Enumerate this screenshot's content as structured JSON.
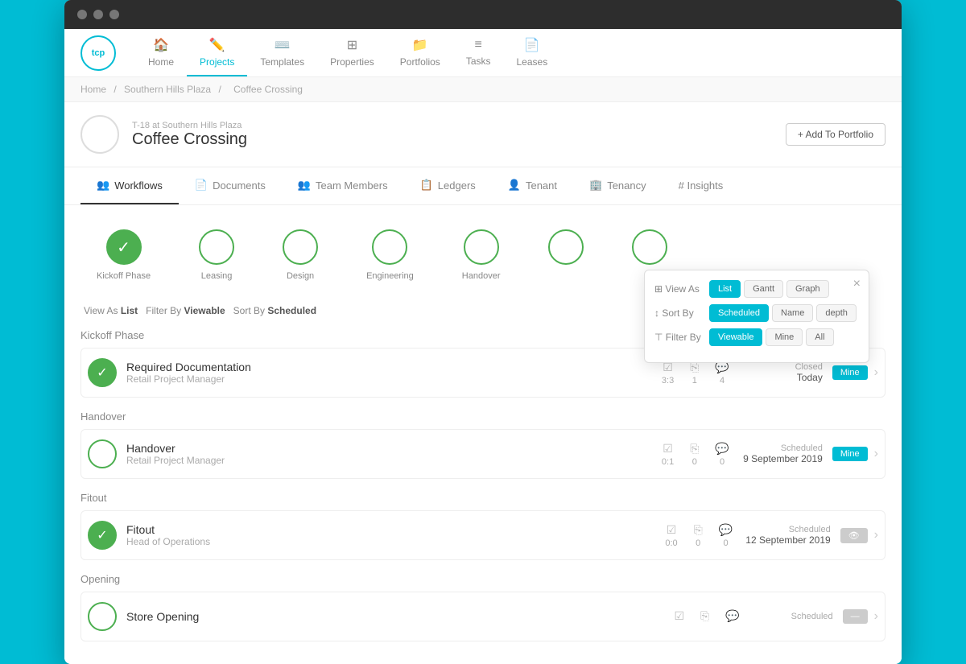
{
  "browser": {
    "dots": [
      "dot1",
      "dot2",
      "dot3"
    ]
  },
  "nav": {
    "logo": "tcp",
    "items": [
      {
        "id": "home",
        "label": "Home",
        "icon": "🏠",
        "active": false
      },
      {
        "id": "projects",
        "label": "Projects",
        "icon": "📐",
        "active": true
      },
      {
        "id": "templates",
        "label": "Templates",
        "icon": "</>",
        "active": false
      },
      {
        "id": "properties",
        "label": "Properties",
        "icon": "⊞",
        "active": false
      },
      {
        "id": "portfolios",
        "label": "Portfolios",
        "icon": "📁",
        "active": false
      },
      {
        "id": "tasks",
        "label": "Tasks",
        "icon": "≡",
        "active": false
      },
      {
        "id": "leases",
        "label": "Leases",
        "icon": "📄",
        "active": false
      }
    ]
  },
  "breadcrumb": {
    "parts": [
      "Home",
      "Southern Hills Plaza",
      "Coffee Crossing"
    ]
  },
  "project": {
    "sub_title": "T-18 at Southern Hills Plaza",
    "title": "Coffee Crossing",
    "add_portfolio_label": "+ Add To Portfolio"
  },
  "tabs": [
    {
      "id": "workflows",
      "label": "Workflows",
      "icon": "👥",
      "active": true
    },
    {
      "id": "documents",
      "label": "Documents",
      "icon": "📄",
      "active": false
    },
    {
      "id": "team_members",
      "label": "Team Members",
      "icon": "👥",
      "active": false
    },
    {
      "id": "ledgers",
      "label": "Ledgers",
      "icon": "📋",
      "active": false
    },
    {
      "id": "tenant",
      "label": "Tenant",
      "icon": "👤",
      "active": false
    },
    {
      "id": "tenancy",
      "label": "Tenancy",
      "icon": "🏢",
      "active": false
    },
    {
      "id": "insights",
      "label": "# Insights",
      "icon": "#",
      "active": false
    }
  ],
  "workflow_phases": [
    {
      "id": "kickoff",
      "label": "Kickoff Phase",
      "filled": true
    },
    {
      "id": "leasing",
      "label": "Leasing",
      "filled": false
    },
    {
      "id": "design",
      "label": "Design",
      "filled": false
    },
    {
      "id": "engineering",
      "label": "Engineering",
      "filled": false
    },
    {
      "id": "handover",
      "label": "Handover",
      "filled": false
    },
    {
      "id": "phase6",
      "label": "",
      "filled": false
    },
    {
      "id": "phase7",
      "label": "",
      "filled": false
    }
  ],
  "view_controls": {
    "view_as_label": "View As",
    "view_as_value": "List",
    "filter_by_label": "Filter By",
    "filter_by_value": "Viewable",
    "sort_by_label": "Sort By",
    "sort_by_value": "Scheduled"
  },
  "sections": [
    {
      "id": "kickoff",
      "label": "Kickoff Phase",
      "tasks": [
        {
          "id": "req_doc",
          "name": "Required Documentation",
          "role": "Retail Project Manager",
          "filled": true,
          "checks": "3:3",
          "copies": "1",
          "comments": "4",
          "status": "Closed",
          "date": "Today",
          "tag": "Mine",
          "tag_style": "cyan"
        }
      ]
    },
    {
      "id": "handover",
      "label": "Handover",
      "tasks": [
        {
          "id": "handover_task",
          "name": "Handover",
          "role": "Retail Project Manager",
          "filled": false,
          "checks": "0:1",
          "copies": "0",
          "comments": "0",
          "status": "Scheduled",
          "date": "9 September 2019",
          "tag": "Mine",
          "tag_style": "cyan"
        }
      ]
    },
    {
      "id": "fitout",
      "label": "Fitout",
      "tasks": [
        {
          "id": "fitout_task",
          "name": "Fitout",
          "role": "Head of Operations",
          "filled": true,
          "checks": "0:0",
          "copies": "0",
          "comments": "0",
          "status": "Scheduled",
          "date": "12 September 2019",
          "tag": "eye",
          "tag_style": "gray"
        }
      ]
    },
    {
      "id": "opening",
      "label": "Opening",
      "tasks": [
        {
          "id": "store_opening",
          "name": "Store Opening",
          "role": "",
          "filled": false,
          "checks": "",
          "copies": "",
          "comments": "",
          "status": "Scheduled",
          "date": "",
          "tag": "",
          "tag_style": ""
        }
      ]
    }
  ],
  "popup": {
    "view_as_label": "View As",
    "sort_by_label": "Sort By",
    "filter_by_label": "Filter By",
    "view_options": [
      {
        "label": "List",
        "active": true
      },
      {
        "label": "Gantt",
        "active": false
      },
      {
        "label": "Graph",
        "active": false
      }
    ],
    "sort_options": [
      {
        "label": "Scheduled",
        "active": true
      },
      {
        "label": "Name",
        "active": false
      },
      {
        "label": "depth",
        "active": false
      }
    ],
    "filter_options": [
      {
        "label": "Viewable",
        "active": true
      },
      {
        "label": "Mine",
        "active": false
      },
      {
        "label": "All",
        "active": false
      }
    ],
    "close_label": "×"
  }
}
